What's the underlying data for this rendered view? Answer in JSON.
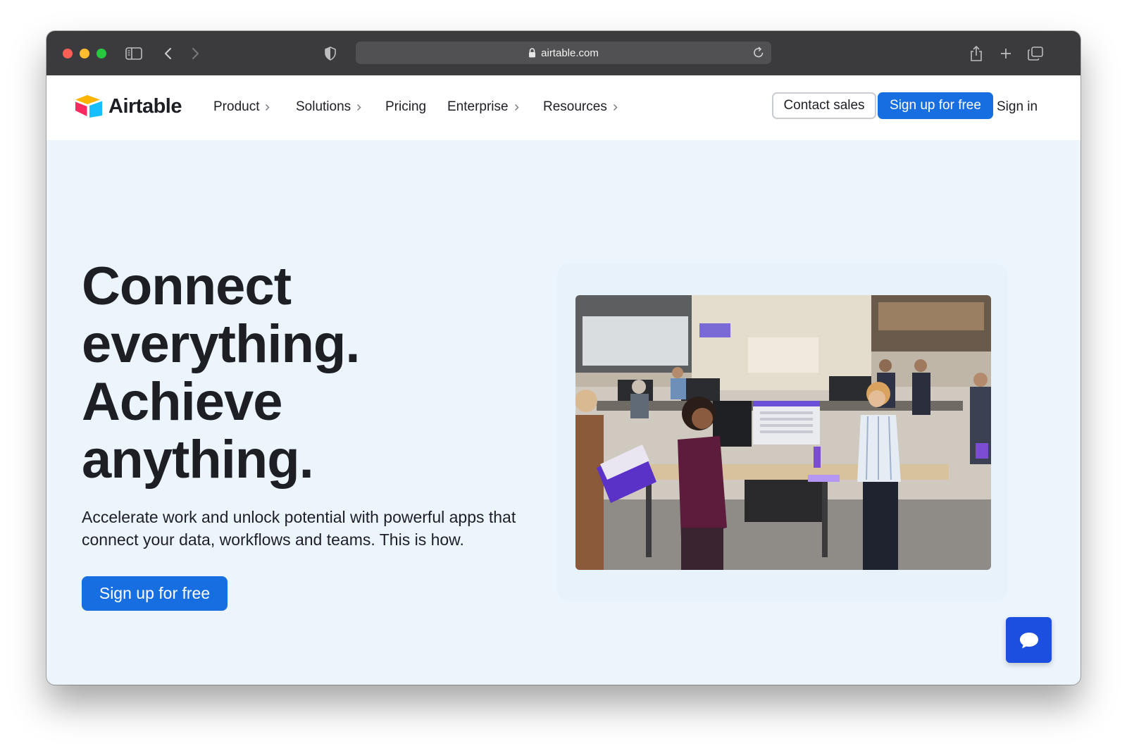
{
  "browser": {
    "url": "airtable.com",
    "icons": [
      "sidebar-icon",
      "back-arrow-icon",
      "forward-arrow-icon",
      "shield-icon",
      "lock-icon",
      "reload-icon",
      "share-icon",
      "new-tab-icon",
      "tabs-overview-icon"
    ]
  },
  "nav": {
    "brand": "Airtable",
    "items": [
      {
        "label": "Product",
        "has_chevron": true
      },
      {
        "label": "Solutions",
        "has_chevron": true
      },
      {
        "label": "Pricing",
        "has_chevron": false
      },
      {
        "label": "Enterprise",
        "has_chevron": true
      },
      {
        "label": "Resources",
        "has_chevron": true
      }
    ],
    "contact_sales": "Contact sales",
    "signup": "Sign up for free",
    "signin": "Sign in"
  },
  "hero": {
    "title_lines": [
      "Connect",
      "everything.",
      "Achieve",
      "anything."
    ],
    "subtitle": "Accelerate work and unlock potential with powerful apps that connect your data, workflows and teams. This is how.",
    "cta": "Sign up for free"
  },
  "colors": {
    "brand_blue": "#166ee1",
    "hero_background": "#ecf5fc",
    "chrome_dark": "#3b3b3d",
    "chat_button": "#1c4fe0"
  }
}
